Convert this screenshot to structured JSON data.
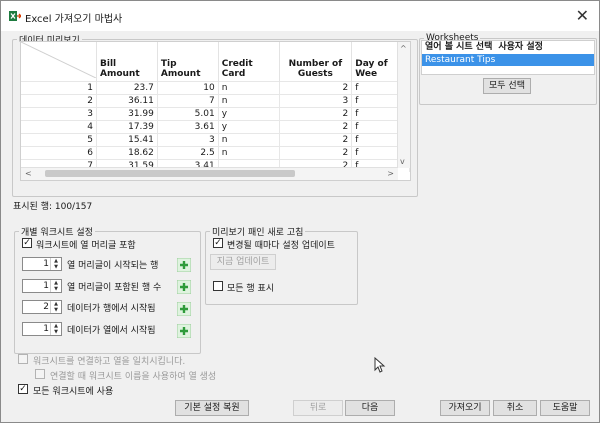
{
  "window": {
    "title": "Excel 가져오기 마법사",
    "close_glyph": "✕",
    "icon": "excel-icon"
  },
  "preview": {
    "legend": "데이터 미리보기",
    "columns": [
      "",
      "Bill Amount",
      "Tip Amount",
      "Credit Card",
      "Number of Guests",
      "Day of Wee"
    ],
    "rows": [
      [
        "1",
        "23.7",
        "10",
        "n",
        "2",
        "f"
      ],
      [
        "2",
        "36.11",
        "7",
        "n",
        "3",
        "f"
      ],
      [
        "3",
        "31.99",
        "5.01",
        "y",
        "2",
        "f"
      ],
      [
        "4",
        "17.39",
        "3.61",
        "y",
        "2",
        "f"
      ],
      [
        "5",
        "15.41",
        "3",
        "n",
        "2",
        "f"
      ],
      [
        "6",
        "18.62",
        "2.5",
        "n",
        "2",
        "f"
      ],
      [
        "7",
        "31.59",
        "3.41",
        "",
        "2",
        "f"
      ]
    ],
    "rows_shown_label": "표시된 행: 100/157"
  },
  "worksheets": {
    "legend": "Worksheets",
    "header_select": "열어 볼 시트 선택",
    "header_user": "사용자 설정",
    "items": [
      "Restaurant Tips"
    ],
    "select_all_button": "모두 선택"
  },
  "individual": {
    "legend": "개별 워크시트 설정",
    "header_checkbox_label": "워크시트에 열 머리글 포함",
    "header_checkbox_checked": true,
    "spinners": [
      {
        "value": "1",
        "label": "열 머리글이 시작되는 행"
      },
      {
        "value": "1",
        "label": "열 머리글이 포함된 행 수"
      },
      {
        "value": "2",
        "label": "데이터가 행에서 시작됨"
      },
      {
        "value": "1",
        "label": "데이터가 열에서 시작됨"
      }
    ]
  },
  "refresh": {
    "legend": "미리보기 패인 새로 고침",
    "auto_update_label": "변경될 때마다 설정 업데이트",
    "auto_update_checked": true,
    "update_now_button": "지금 업데이트",
    "show_all_rows_label": "모든 행 표시",
    "show_all_rows_checked": false
  },
  "options": {
    "concat_label": "워크시트를 연결하고 열을 일치시킵니다.",
    "sheetname_col_label": "연결할 때 워크시트 이름을 사용하여 열 생성",
    "all_sheets_label": "모든 워크시트에 사용",
    "all_sheets_checked": true
  },
  "buttons": {
    "restore_defaults": "기본 설정 복원",
    "back": "뒤로",
    "next": "다음",
    "import": "가져오기",
    "cancel": "취소",
    "help": "도움말"
  },
  "colors": {
    "selection": "#3b92e8",
    "plus_green": "#2e9b3a"
  }
}
